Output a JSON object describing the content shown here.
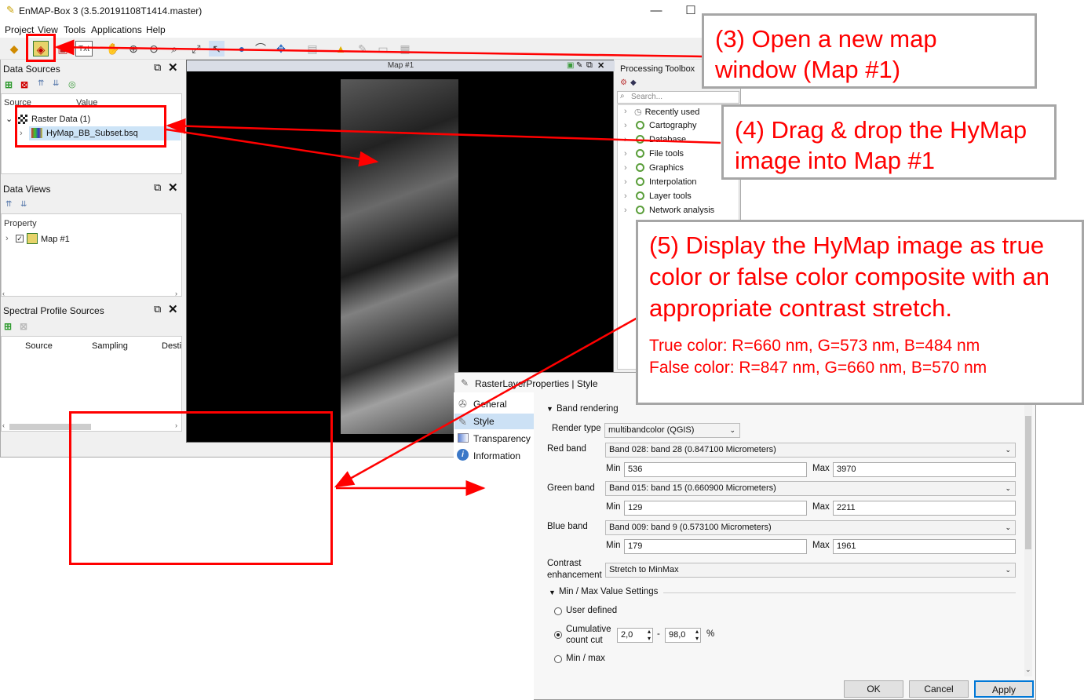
{
  "window": {
    "title": "EnMAP-Box 3 (3.5.20191108T1414.master)",
    "minimize": "—",
    "maximize": "☐",
    "close": "✕"
  },
  "menu": [
    "Project",
    "View",
    "Tools",
    "Applications",
    "Help"
  ],
  "toolbar": {
    "txt_label": "Txt"
  },
  "data_sources": {
    "title": "Data Sources",
    "columns": [
      "Source",
      "Value"
    ],
    "group": "Raster Data (1)",
    "item": "HyMap_BB_Subset.bsq"
  },
  "data_views": {
    "title": "Data Views",
    "column": "Property",
    "item": "Map #1"
  },
  "spectral": {
    "title": "Spectral Profile Sources",
    "columns": [
      "Source",
      "Sampling",
      "Desti"
    ]
  },
  "map": {
    "title": "Map #1"
  },
  "toolbox": {
    "title": "Processing Toolbox",
    "search_placeholder": "Search...",
    "items": [
      "Recently used",
      "Cartography",
      "Database",
      "File tools",
      "Graphics",
      "Interpolation",
      "Layer tools",
      "Network analysis"
    ]
  },
  "callouts": {
    "c3": "(3) Open a new map window (Map #1)",
    "c4": "(4) Drag & drop the HyMap image into Map #1",
    "c5": "(5) Display the HyMap image as true color or false color composite with an appropriate contrast stretch.",
    "c5_true": "True color: R=660 nm, G=573 nm, B=484 nm",
    "c5_false": "False color: R=847 nm, G=660 nm, B=570 nm"
  },
  "dialog": {
    "title": "RasterLayerProperties | Style",
    "sidebar": [
      "General",
      "Style",
      "Transparency",
      "Information"
    ],
    "band_rendering": "Band rendering",
    "render_type_label": "Render type",
    "render_type": "multibandcolor (QGIS)",
    "red_label": "Red band",
    "red_band": "Band 028: band 28 (0.847100 Micrometers)",
    "red_min": "536",
    "red_max": "3970",
    "green_label": "Green band",
    "green_band": "Band 015: band 15 (0.660900 Micrometers)",
    "green_min": "129",
    "green_max": "2211",
    "blue_label": "Blue band",
    "blue_band": "Band 009: band 9 (0.573100 Micrometers)",
    "blue_min": "179",
    "blue_max": "1961",
    "min_label": "Min",
    "max_label": "Max",
    "contrast_label_1": "Contrast",
    "contrast_label_2": "enhancement",
    "contrast": "Stretch to MinMax",
    "minmax_settings": "Min / Max Value Settings",
    "user_defined": "User defined",
    "cumulative_1": "Cumulative",
    "cumulative_2": "count cut",
    "cut_low": "2,0",
    "cut_high": "98,0",
    "dash": "-",
    "percent": "%",
    "min_max": "Min / max",
    "ok": "OK",
    "cancel": "Cancel",
    "apply": "Apply"
  }
}
